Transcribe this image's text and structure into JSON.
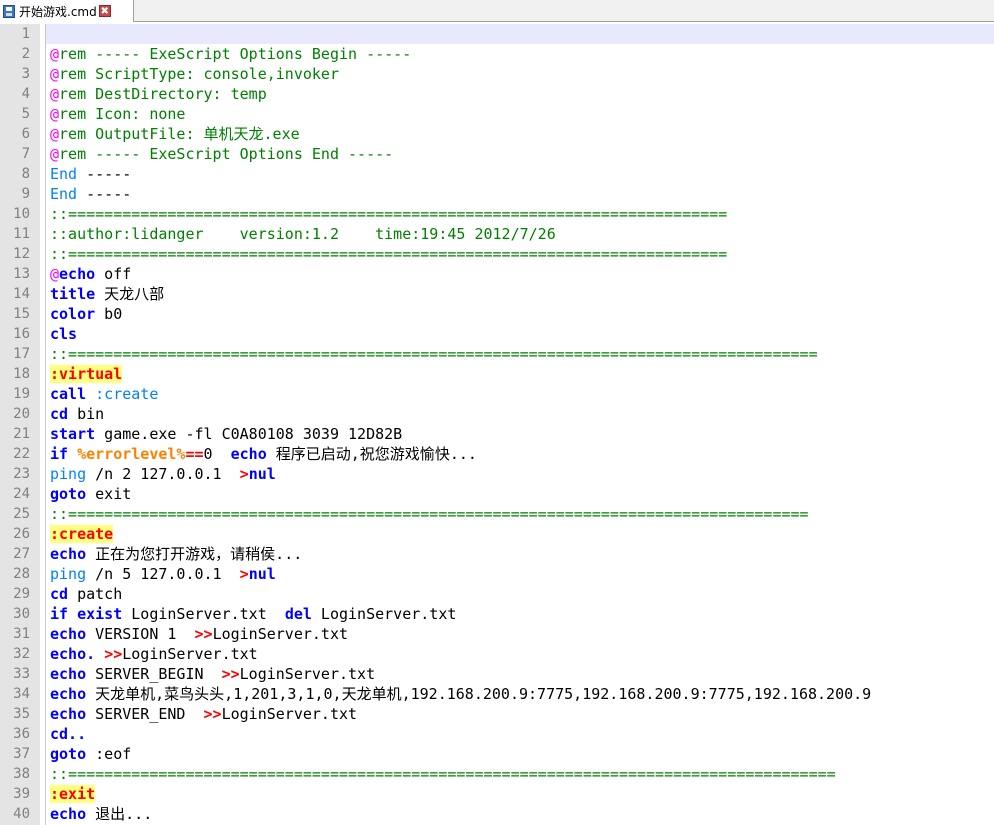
{
  "tab": {
    "filename": "开始游戏.cmd",
    "close_glyph": "✖"
  },
  "colors": {
    "comment": "#008000",
    "keyword": "#0000ff",
    "keyword_light": "#0080ff",
    "operator": "#ff0000",
    "variable": "#ff8000",
    "label_highlight": "#ffff80",
    "current_line": "#e8e8ff",
    "gutter": "#e4e4e4"
  },
  "editor": {
    "current_line": 1,
    "lines": [
      {
        "n": "1",
        "t": []
      },
      {
        "n": "2",
        "t": [
          [
            "at",
            "@"
          ],
          [
            "cmt",
            "rem ----- ExeScript Options Begin -----"
          ]
        ]
      },
      {
        "n": "3",
        "t": [
          [
            "at",
            "@"
          ],
          [
            "cmt",
            "rem ScriptType: console,invoker"
          ]
        ]
      },
      {
        "n": "4",
        "t": [
          [
            "at",
            "@"
          ],
          [
            "cmt",
            "rem DestDirectory: temp"
          ]
        ]
      },
      {
        "n": "5",
        "t": [
          [
            "at",
            "@"
          ],
          [
            "cmt",
            "rem Icon: none"
          ]
        ]
      },
      {
        "n": "6",
        "t": [
          [
            "at",
            "@"
          ],
          [
            "cmt",
            "rem OutputFile: 单机天龙.exe"
          ]
        ]
      },
      {
        "n": "7",
        "t": [
          [
            "at",
            "@"
          ],
          [
            "cmt",
            "rem ----- ExeScript Options End -----"
          ]
        ]
      },
      {
        "n": "8",
        "t": [
          [
            "kw2",
            "End"
          ],
          [
            "norm",
            " -----"
          ]
        ]
      },
      {
        "n": "9",
        "t": [
          [
            "kw2",
            "End"
          ],
          [
            "norm",
            " -----"
          ]
        ]
      },
      {
        "n": "10",
        "t": [
          [
            "cmt",
            "::========================================================================="
          ]
        ]
      },
      {
        "n": "11",
        "t": [
          [
            "cmt",
            "::author:lidanger    version:1.2    time:19:45 2012/7/26"
          ]
        ]
      },
      {
        "n": "12",
        "t": [
          [
            "cmt",
            "::========================================================================="
          ]
        ]
      },
      {
        "n": "13",
        "t": [
          [
            "at",
            "@"
          ],
          [
            "kw",
            "echo"
          ],
          [
            "norm",
            " off"
          ]
        ]
      },
      {
        "n": "14",
        "t": [
          [
            "kw",
            "title"
          ],
          [
            "norm",
            " 天龙八部"
          ]
        ]
      },
      {
        "n": "15",
        "t": [
          [
            "kw",
            "color"
          ],
          [
            "norm",
            " b0"
          ]
        ]
      },
      {
        "n": "16",
        "t": [
          [
            "kw",
            "cls"
          ]
        ]
      },
      {
        "n": "17",
        "t": [
          [
            "cmt",
            "::==================================================================================="
          ]
        ]
      },
      {
        "n": "18",
        "t": [
          [
            "lbl",
            ":virtual"
          ]
        ]
      },
      {
        "n": "19",
        "t": [
          [
            "kw",
            "call"
          ],
          [
            "norm",
            " "
          ],
          [
            "kw2",
            ":create"
          ]
        ]
      },
      {
        "n": "20",
        "t": [
          [
            "kw",
            "cd"
          ],
          [
            "norm",
            " bin"
          ]
        ]
      },
      {
        "n": "21",
        "t": [
          [
            "kw",
            "start"
          ],
          [
            "norm",
            " game.exe -fl C0A80108 3039 12D82B"
          ]
        ]
      },
      {
        "n": "22",
        "t": [
          [
            "kw",
            "if"
          ],
          [
            "norm",
            " "
          ],
          [
            "var",
            "%errorlevel%"
          ],
          [
            "red",
            "=="
          ],
          [
            "norm",
            "0  "
          ],
          [
            "kw",
            "echo"
          ],
          [
            "norm",
            " 程序已启动,祝您游戏愉快..."
          ]
        ]
      },
      {
        "n": "23",
        "t": [
          [
            "kw2",
            "ping"
          ],
          [
            "norm",
            " /n 2 127.0.0.1  "
          ],
          [
            "red",
            ">"
          ],
          [
            "nul",
            "nul"
          ]
        ]
      },
      {
        "n": "24",
        "t": [
          [
            "kw",
            "goto"
          ],
          [
            "norm",
            " exit"
          ]
        ]
      },
      {
        "n": "25",
        "t": [
          [
            "cmt",
            "::=================================================================================="
          ]
        ]
      },
      {
        "n": "26",
        "t": [
          [
            "lbl",
            ":create"
          ]
        ]
      },
      {
        "n": "27",
        "t": [
          [
            "kw",
            "echo"
          ],
          [
            "norm",
            " 正在为您打开游戏，请稍侯..."
          ]
        ]
      },
      {
        "n": "28",
        "t": [
          [
            "kw2",
            "ping"
          ],
          [
            "norm",
            " /n 5 127.0.0.1  "
          ],
          [
            "red",
            ">"
          ],
          [
            "nul",
            "nul"
          ]
        ]
      },
      {
        "n": "29",
        "t": [
          [
            "kw",
            "cd"
          ],
          [
            "norm",
            " patch"
          ]
        ]
      },
      {
        "n": "30",
        "t": [
          [
            "kw",
            "if"
          ],
          [
            "norm",
            " "
          ],
          [
            "kw",
            "exist"
          ],
          [
            "norm",
            " LoginServer.txt  "
          ],
          [
            "kw",
            "del"
          ],
          [
            "norm",
            " LoginServer.txt"
          ]
        ]
      },
      {
        "n": "31",
        "t": [
          [
            "kw",
            "echo"
          ],
          [
            "norm",
            " VERSION 1  "
          ],
          [
            "red",
            ">>"
          ],
          [
            "norm",
            "LoginServer.txt"
          ]
        ]
      },
      {
        "n": "32",
        "t": [
          [
            "kw",
            "echo."
          ],
          [
            "norm",
            " "
          ],
          [
            "red",
            ">>"
          ],
          [
            "norm",
            "LoginServer.txt"
          ]
        ]
      },
      {
        "n": "33",
        "t": [
          [
            "kw",
            "echo"
          ],
          [
            "norm",
            " SERVER_BEGIN  "
          ],
          [
            "red",
            ">>"
          ],
          [
            "norm",
            "LoginServer.txt"
          ]
        ]
      },
      {
        "n": "34",
        "t": [
          [
            "kw",
            "echo"
          ],
          [
            "norm",
            " 天龙单机,菜鸟头头,1,201,3,1,0,天龙单机,192.168.200.9:7775,192.168.200.9:7775,192.168.200.9"
          ]
        ]
      },
      {
        "n": "35",
        "t": [
          [
            "kw",
            "echo"
          ],
          [
            "norm",
            " SERVER_END  "
          ],
          [
            "red",
            ">>"
          ],
          [
            "norm",
            "LoginServer.txt"
          ]
        ]
      },
      {
        "n": "36",
        "t": [
          [
            "kw",
            "cd.."
          ]
        ]
      },
      {
        "n": "37",
        "t": [
          [
            "kw",
            "goto"
          ],
          [
            "norm",
            " :eof"
          ]
        ]
      },
      {
        "n": "38",
        "t": [
          [
            "cmt",
            "::====================================================================================="
          ]
        ]
      },
      {
        "n": "39",
        "t": [
          [
            "lbl",
            ":exit"
          ]
        ]
      },
      {
        "n": "40",
        "t": [
          [
            "kw",
            "echo"
          ],
          [
            "norm",
            " 退出..."
          ]
        ]
      }
    ]
  }
}
